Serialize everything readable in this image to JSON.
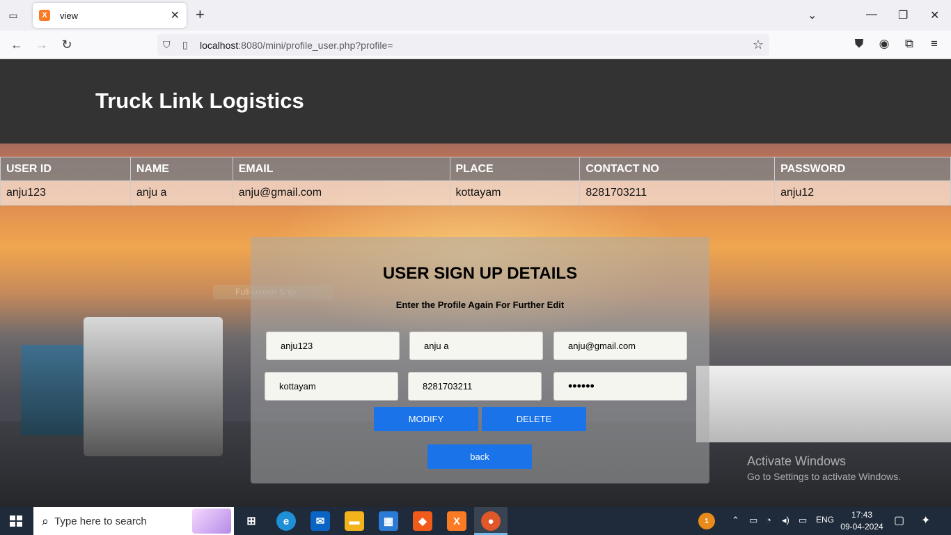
{
  "browser": {
    "tab_title": "view",
    "url_host": "localhost",
    "url_rest": ":8080/mini/profile_user.php?profile=",
    "favicon_letter": "X"
  },
  "site": {
    "title": "Truck Link Logistics"
  },
  "table": {
    "headers": [
      "USER ID",
      "NAME",
      "EMAIL",
      "PLACE",
      "CONTACT NO",
      "PASSWORD"
    ],
    "row": [
      "anju123",
      "anju a",
      "anju@gmail.com",
      "kottayam",
      "8281703211",
      "anju12"
    ]
  },
  "form": {
    "title": "USER SIGN UP DETAILS",
    "subtitle": "Enter the Profile Again For Further Edit",
    "user_id": "anju123",
    "name": "anju a",
    "email": "anju@gmail.com",
    "place": "kottayam",
    "contact": "8281703211",
    "password": "anju12",
    "modify_label": "MODIFY",
    "delete_label": "DELETE",
    "back_label": "back"
  },
  "overlay": {
    "snip_label": "Full-screen Snip",
    "activate_title": "Activate Windows",
    "activate_sub": "Go to Settings to activate Windows."
  },
  "taskbar": {
    "search_placeholder": "Type here to search",
    "lang": "ENG",
    "time": "17:43",
    "date": "09-04-2024",
    "notification_badge": "1"
  },
  "colors": {
    "header_bg": "#333333",
    "button_blue": "#1a73e8",
    "taskbar_bg": "#1f2a3a"
  }
}
